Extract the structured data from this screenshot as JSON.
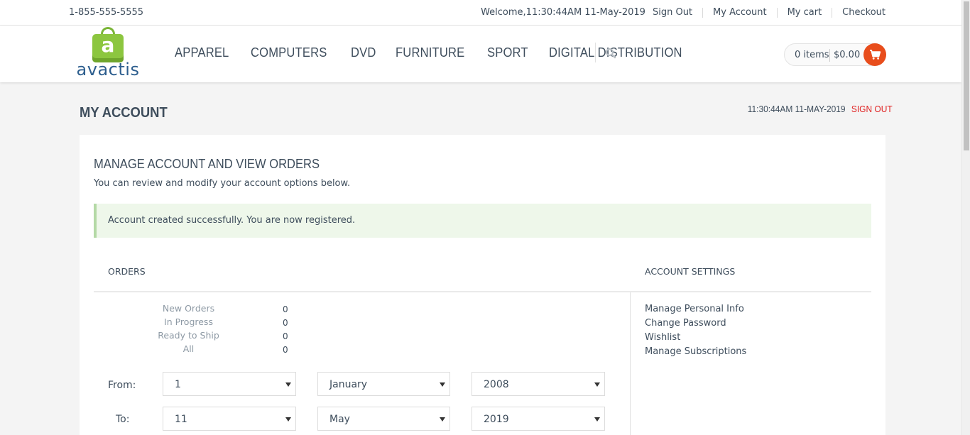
{
  "topbar": {
    "phone": "1-855-555-5555",
    "welcome": "Welcome,11:30:44AM 11-May-2019",
    "links": [
      "Sign Out",
      "My Account",
      "My cart",
      "Checkout"
    ]
  },
  "header": {
    "logo_letter": "a",
    "logo_text": "avactis",
    "nav": [
      "APPAREL",
      "COMPUTERS",
      "DVD",
      "FURNITURE",
      "SPORT",
      "DIGITAL DISTRIBUTION"
    ],
    "cart_items": "0 items",
    "cart_total": "$0.00"
  },
  "page": {
    "title": "MY ACCOUNT",
    "timestamp": "11:30:44AM 11-MAY-2019",
    "sign_out": "SIGN OUT"
  },
  "panel": {
    "heading": "MANAGE ACCOUNT AND VIEW ORDERS",
    "subtitle": "You can review and modify your account options below.",
    "alert": "Account created successfully. You are now registered.",
    "orders_heading": "ORDERS",
    "settings_heading": "ACCOUNT SETTINGS",
    "order_stats": [
      {
        "label": "New Orders",
        "value": "0"
      },
      {
        "label": "In Progress",
        "value": "0"
      },
      {
        "label": "Ready to Ship",
        "value": "0"
      },
      {
        "label": "All",
        "value": "0"
      }
    ],
    "from_label": "From:",
    "to_label": "To:",
    "from": {
      "day": "1",
      "month": "January",
      "year": "2008"
    },
    "to": {
      "day": "11",
      "month": "May",
      "year": "2019"
    },
    "settings_links": [
      "Manage Personal Info",
      "Change Password",
      "Wishlist",
      "Manage Subscriptions"
    ]
  },
  "colors": {
    "accent_red": "#e02222",
    "cart_button": "#e84d1c",
    "alert_bg": "#eef7ea",
    "logo_green": "#8cc63f",
    "logo_blue": "#2d5e8e"
  }
}
